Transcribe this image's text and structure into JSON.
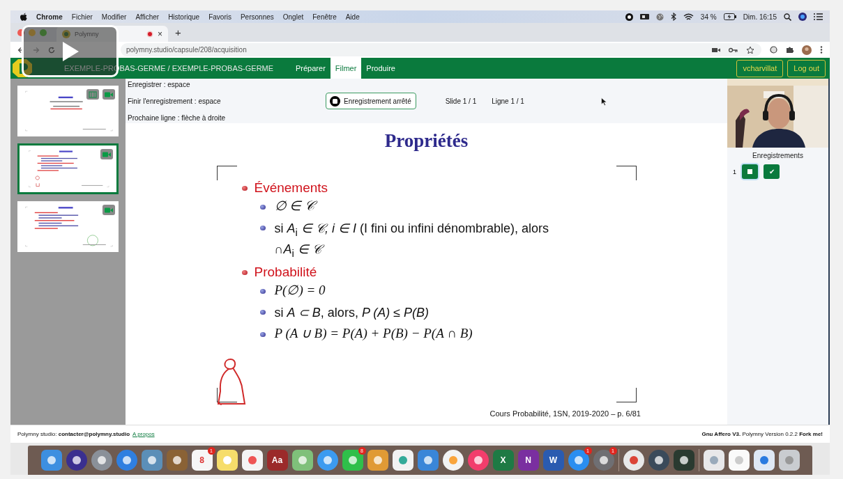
{
  "menu_bar": {
    "app": "Chrome",
    "items": [
      "Fichier",
      "Modifier",
      "Afficher",
      "Historique",
      "Favoris",
      "Personnes",
      "Onglet",
      "Fenêtre",
      "Aide"
    ],
    "battery": "34 %",
    "clock": "Dim. 16:15"
  },
  "browser": {
    "tabs": [
      {
        "title": "Polymny",
        "recording": true,
        "close": "×",
        "selected": true
      }
    ],
    "new_tab": "+",
    "url": "polymny.studio/capsule/208/acquisition"
  },
  "app_header": {
    "title": "EXEMPLE-PROBAS-GERME / EXEMPLE-PROBAS-GERME",
    "tabs": [
      {
        "label": "Préparer",
        "selected": false
      },
      {
        "label": "Filmer",
        "selected": true
      },
      {
        "label": "Produire",
        "selected": false
      }
    ],
    "user": "vcharvillat",
    "logout": "Log out"
  },
  "slides": [
    {
      "selected": false,
      "kind": "title",
      "buttons": [
        {
          "kind": "film"
        },
        {
          "kind": "camera"
        }
      ]
    },
    {
      "selected": true,
      "kind": "list",
      "buttons": [
        {
          "kind": "camera"
        }
      ]
    },
    {
      "selected": false,
      "kind": "list",
      "buttons": [
        {
          "kind": "camera"
        }
      ]
    }
  ],
  "shortcuts": [
    "Enregistrer : espace",
    "Finir l'enregistrement : espace",
    "Prochaine ligne : flèche à droite"
  ],
  "record_button": {
    "label": "Enregistrement arrêté",
    "recording": false
  },
  "slide_counter": "Slide 1 / 1",
  "line_counter": "Ligne 1 / 1",
  "slide": {
    "title": "Propriétés",
    "items": [
      {
        "text": "Événements",
        "children": [
          {
            "kind": "math",
            "text": "∅ ∈ 𝒞"
          },
          {
            "kind": "text",
            "text": "si *A*$_{i}$ *∈ 𝒞, i ∈ I* (I fini ou infini dénombrable), alors ∩*A*$_{i}$ *∈ 𝒞*"
          }
        ]
      },
      {
        "text": "Probabilité",
        "children": [
          {
            "kind": "math",
            "text": "P(∅) = 0"
          },
          {
            "kind": "text",
            "text": "si *A ⊂ B*, alors, *P (A) ≤ P(B)*"
          },
          {
            "kind": "math",
            "text": "P (A ∪ B) = P(A) + P(B) − P(A ∩ B)"
          }
        ]
      }
    ],
    "footer": "Cours Probabilité, 1SN, 2019-2020 – p. 6/81"
  },
  "recordings": {
    "title": "Enregistrements",
    "items": [
      {
        "number": "1",
        "selected": true,
        "validate": "✔"
      }
    ]
  },
  "footer": {
    "left": "Polymny studio: **contacter@polymny.studio**",
    "link": "A propos",
    "right": "**Gnu Affero V3.**  Polymny Version 0.2.2 **Fork me!**"
  },
  "dock": [
    {
      "kind": "finder"
    },
    {
      "kind": "siri"
    },
    {
      "kind": "rocket"
    },
    {
      "kind": "compass"
    },
    {
      "kind": "preview"
    },
    {
      "kind": "notebook"
    },
    {
      "kind": "calendar",
      "label": "8",
      "badge": "1"
    },
    {
      "kind": "notes"
    },
    {
      "kind": "reminders"
    },
    {
      "kind": "dictionary",
      "label": "Aa"
    },
    {
      "kind": "maps"
    },
    {
      "kind": "messages"
    },
    {
      "kind": "facetime",
      "badge": "8"
    },
    {
      "kind": "pages"
    },
    {
      "kind": "numbers"
    },
    {
      "kind": "keynote"
    },
    {
      "kind": "photos"
    },
    {
      "kind": "music"
    },
    {
      "kind": "excel",
      "label": "X"
    },
    {
      "kind": "onenote",
      "label": "N"
    },
    {
      "kind": "word",
      "label": "W"
    },
    {
      "kind": "appstore",
      "badge": "1"
    },
    {
      "kind": "settings",
      "badge": "1"
    },
    {
      "kind": "separator"
    },
    {
      "kind": "chrome"
    },
    {
      "kind": "quicktime"
    },
    {
      "kind": "monitor"
    },
    {
      "kind": "separator"
    },
    {
      "kind": "folder"
    },
    {
      "kind": "document"
    },
    {
      "kind": "webfile"
    },
    {
      "kind": "trash"
    }
  ]
}
